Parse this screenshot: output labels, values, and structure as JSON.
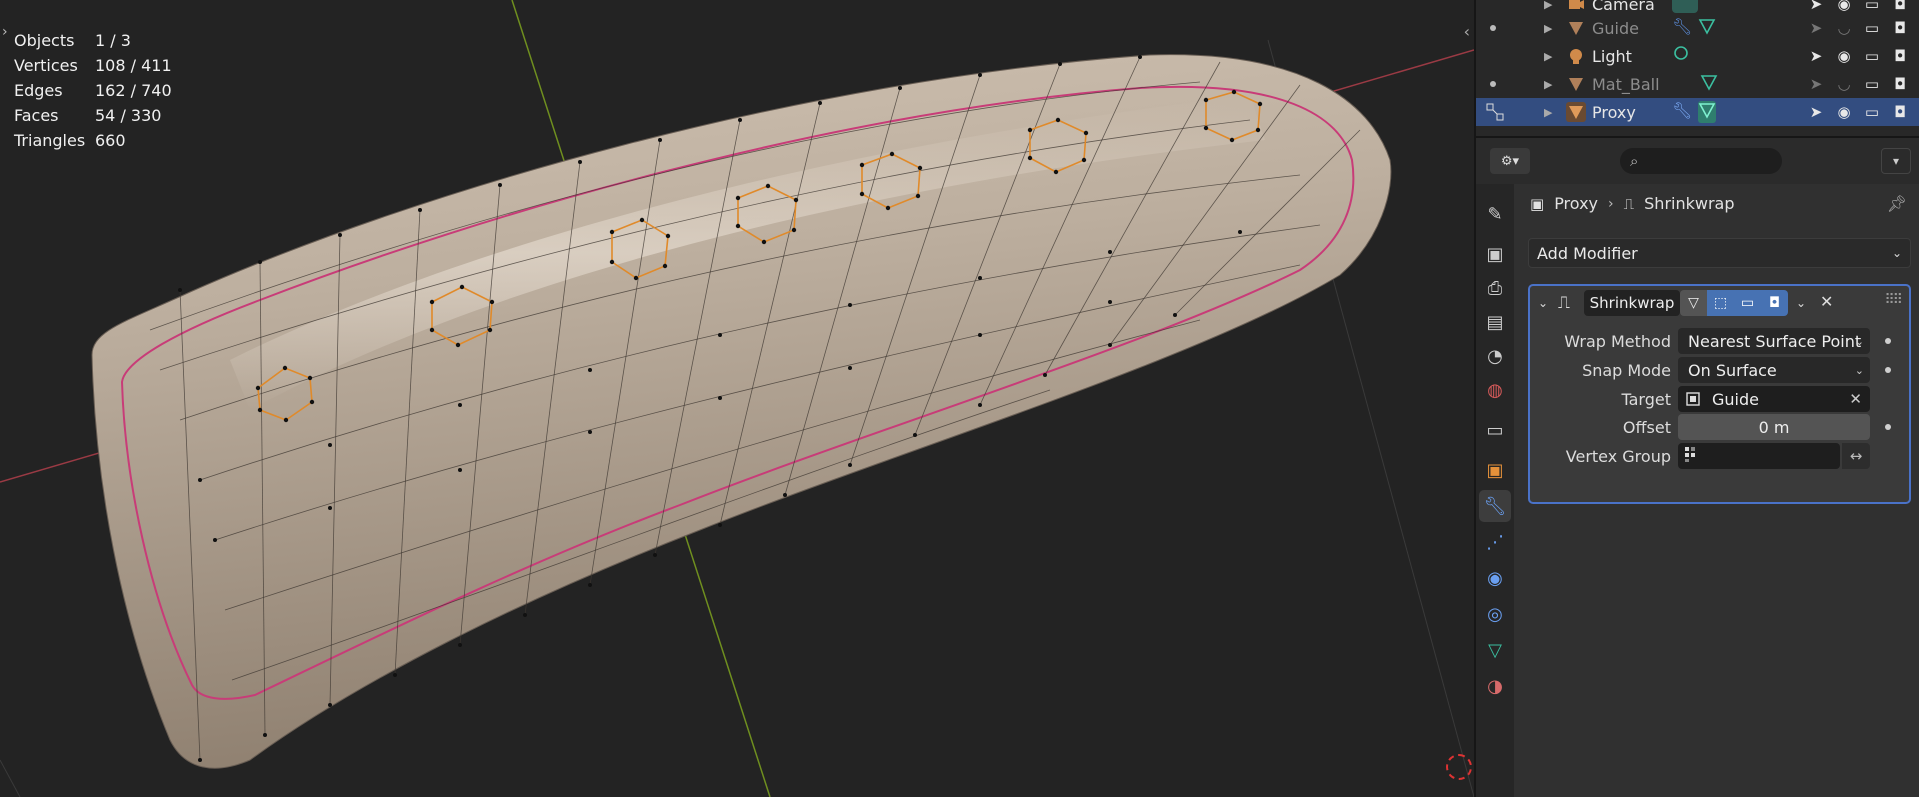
{
  "viewport": {
    "stats": [
      {
        "key": "Objects",
        "value": "1 / 3"
      },
      {
        "key": "Vertices",
        "value": "108 / 411"
      },
      {
        "key": "Edges",
        "value": "162 / 740"
      },
      {
        "key": "Faces",
        "value": "54 / 330"
      },
      {
        "key": "Triangles",
        "value": "660"
      }
    ]
  },
  "outliner": {
    "items": [
      {
        "label": "Camera",
        "dim": false,
        "icon": "camera-icon",
        "selected": false
      },
      {
        "label": "Guide",
        "dim": true,
        "icon": "mesh-icon",
        "selected": false
      },
      {
        "label": "Light",
        "dim": false,
        "icon": "light-icon",
        "selected": false
      },
      {
        "label": "Mat_Ball",
        "dim": true,
        "icon": "mesh-icon",
        "selected": false
      },
      {
        "label": "Proxy",
        "dim": false,
        "icon": "mesh-icon",
        "selected": true
      }
    ]
  },
  "properties": {
    "breadcrumb": {
      "object": "Proxy",
      "modifier": "Shrinkwrap"
    },
    "add_modifier_label": "Add Modifier",
    "modifier": {
      "name": "Shrinkwrap",
      "fields": {
        "wrap_method": {
          "label": "Wrap Method",
          "value": "Nearest Surface Point"
        },
        "snap_mode": {
          "label": "Snap Mode",
          "value": "On Surface"
        },
        "target": {
          "label": "Target",
          "value": "Guide"
        },
        "offset": {
          "label": "Offset",
          "value": "0 m"
        },
        "vertex_group": {
          "label": "Vertex Group",
          "value": ""
        }
      }
    },
    "active_tab": "modifiers-tab"
  },
  "colors": {
    "selection": "#334d80",
    "accent_blue": "#4772b3",
    "mesh_surface": "#b6a797",
    "seam_pink": "#c83c78",
    "axis_x": "#c8434f",
    "axis_y": "#7fa31f"
  }
}
